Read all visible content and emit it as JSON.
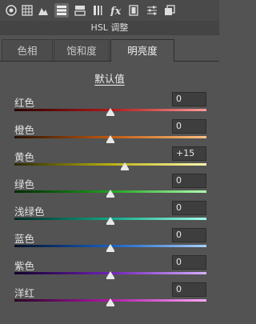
{
  "panel_title": "HSL 调整",
  "tabs": [
    {
      "label": "色相",
      "active": false
    },
    {
      "label": "饱和度",
      "active": false
    },
    {
      "label": "明亮度",
      "active": true
    }
  ],
  "defaults_label": "默认值",
  "sliders": [
    {
      "label": "红色",
      "value": "0",
      "colors": [
        "#2a0000",
        "#b01818",
        "#ff9a9a"
      ]
    },
    {
      "label": "橙色",
      "value": "0",
      "colors": [
        "#2a1200",
        "#c05a10",
        "#ffc080"
      ]
    },
    {
      "label": "黄色",
      "value": "+15",
      "colors": [
        "#2a2800",
        "#b8b010",
        "#fffab0"
      ]
    },
    {
      "label": "绿色",
      "value": "0",
      "colors": [
        "#002a00",
        "#20a020",
        "#b0ffb0"
      ]
    },
    {
      "label": "浅绿色",
      "value": "0",
      "colors": [
        "#002a24",
        "#10a888",
        "#a0ffe8"
      ]
    },
    {
      "label": "蓝色",
      "value": "0",
      "colors": [
        "#00102a",
        "#1860c0",
        "#a8d0ff"
      ]
    },
    {
      "label": "紫色",
      "value": "0",
      "colors": [
        "#12002a",
        "#7020b8",
        "#d8b0ff"
      ]
    },
    {
      "label": "洋红",
      "value": "0",
      "colors": [
        "#2a0026",
        "#b018a8",
        "#ffa8f8"
      ]
    }
  ],
  "slider_range": [
    -100,
    100
  ]
}
